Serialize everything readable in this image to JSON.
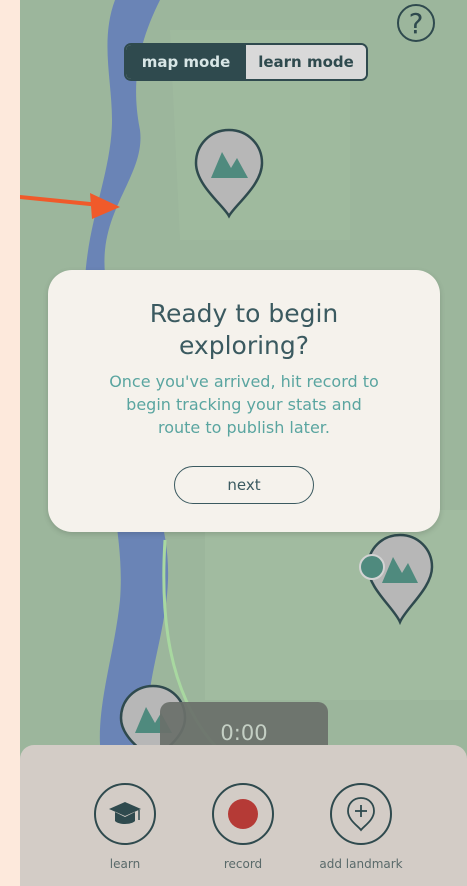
{
  "header": {
    "help_icon_label": "?",
    "mode_toggle": {
      "map_label": "map mode",
      "learn_label": "learn mode",
      "selected": "map mode"
    }
  },
  "dialog": {
    "title_line1": "Ready to begin",
    "title_line2": "exploring?",
    "body_line1": "Once you've arrived, hit record to",
    "body_line2": "begin tracking your stats and",
    "body_line3": "route to publish later.",
    "next_label": "next"
  },
  "timer": {
    "value": "0:00"
  },
  "bottom_nav": {
    "items": [
      {
        "label": "learn",
        "icon": "graduation-cap-icon"
      },
      {
        "label": "record",
        "icon": "record-dot-icon"
      },
      {
        "label": "add landmark",
        "icon": "add-pin-icon"
      }
    ]
  },
  "colors": {
    "map_green": "#9cb69c",
    "river_blue": "#6a84b6",
    "dark_teal": "#2f4a4e",
    "accent_teal": "#5aa5a0",
    "record_red": "#b53a36",
    "annotation_orange": "#f05a2a",
    "trail_green": "#a8d8a0"
  }
}
